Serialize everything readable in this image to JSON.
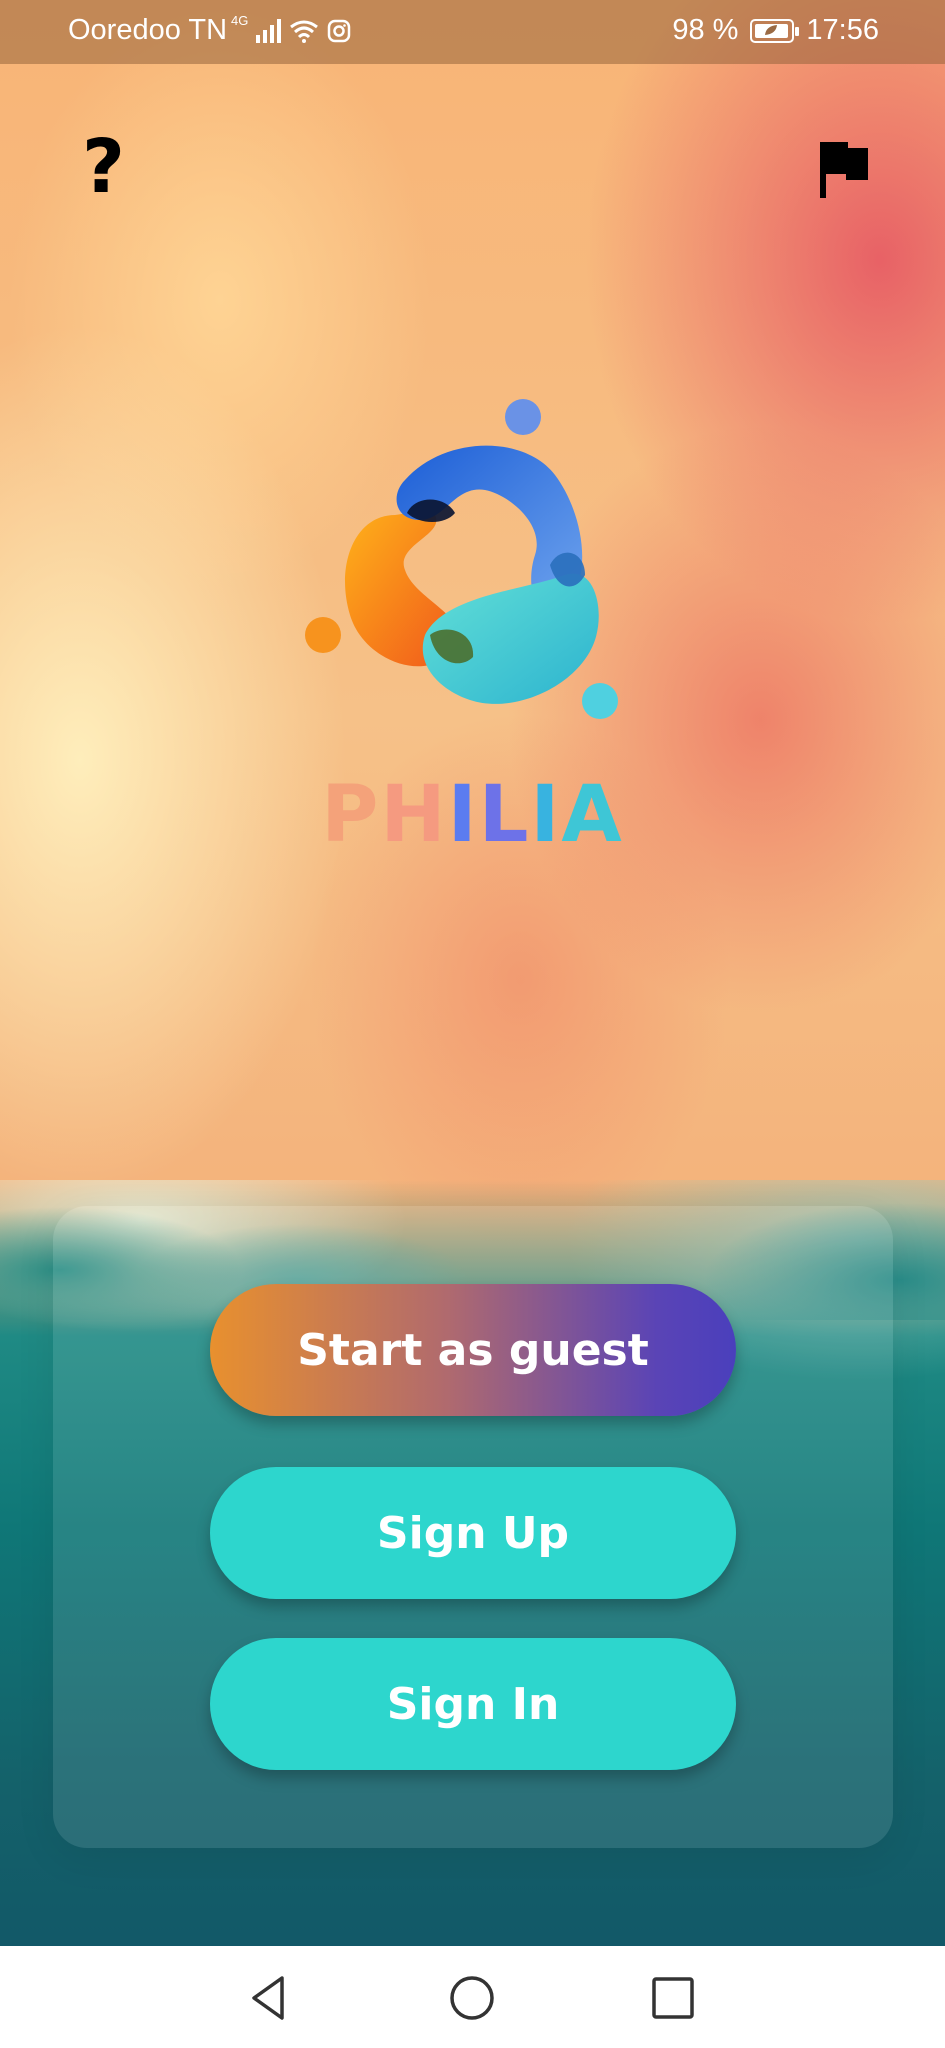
{
  "status_bar": {
    "carrier": "Ooredoo TN",
    "network": "4G",
    "battery": "98 %",
    "time": "17:56"
  },
  "header": {
    "help_symbol": "?",
    "help_icon": "question-mark-icon",
    "flag_icon": "flag-icon"
  },
  "brand": {
    "letters": [
      {
        "char": "P",
        "color": "#f4a27a"
      },
      {
        "char": "H",
        "color": "#f59a80"
      },
      {
        "char": "I",
        "color": "#5b7cf0"
      },
      {
        "char": "L",
        "color": "#6d72e8"
      },
      {
        "char": "I",
        "color": "#38b3e0"
      },
      {
        "char": "A",
        "color": "#3ec6d6"
      }
    ]
  },
  "actions": {
    "guest_label": "Start as guest",
    "signup_label": "Sign Up",
    "signin_label": "Sign In"
  },
  "nav": {
    "back_icon": "back-triangle-icon",
    "home_icon": "home-circle-icon",
    "recent_icon": "recent-apps-square-icon"
  },
  "colors": {
    "accent_teal": "#2dd6cd",
    "gradient_start": "#e8902e",
    "gradient_end": "#4a3fbc"
  }
}
